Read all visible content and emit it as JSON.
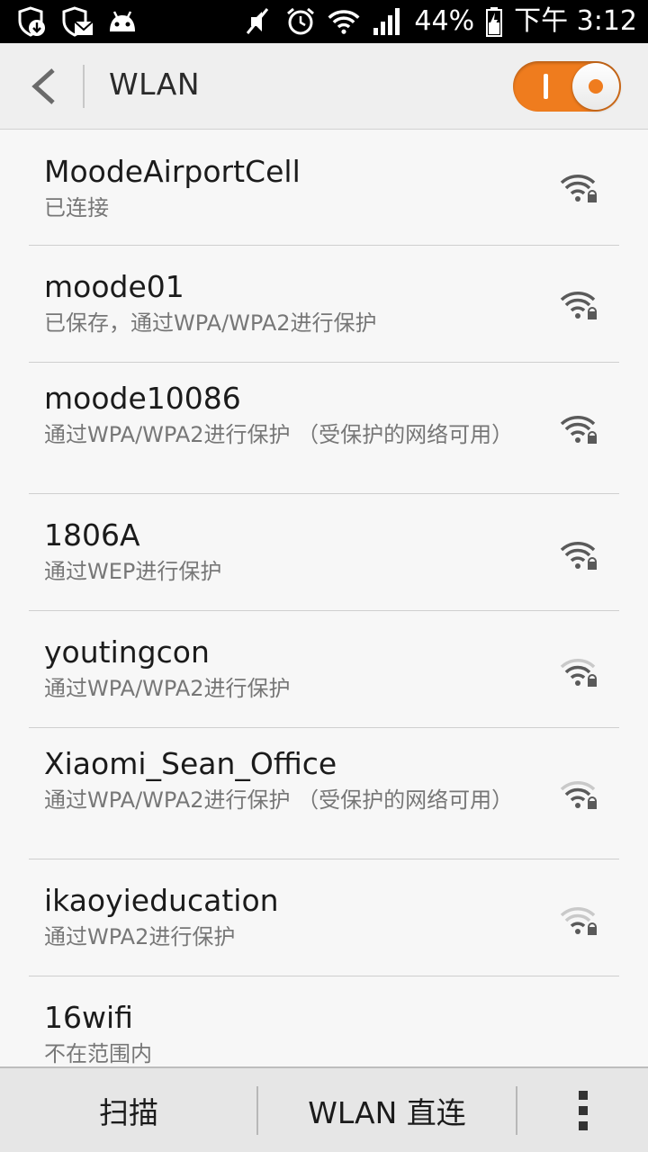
{
  "status_bar": {
    "battery": "44%",
    "time": "下午 3:12",
    "left_icons": [
      "shield-download-icon",
      "shield-mail-icon",
      "android-icon"
    ],
    "right_icons": [
      "mute-icon",
      "alarm-icon",
      "wifi-icon",
      "signal-icon",
      "battery-charging-icon"
    ]
  },
  "header": {
    "title": "WLAN",
    "back_icon": "chevron-left-icon",
    "toggle_on": true,
    "accent_color": "#ef7c1e"
  },
  "networks": [
    {
      "ssid": "MoodeAirportCell",
      "status": "已连接",
      "signal": "strong",
      "locked": true
    },
    {
      "ssid": "moode01",
      "status": "已保存，通过WPA/WPA2进行保护",
      "signal": "strong",
      "locked": true
    },
    {
      "ssid": "moode10086",
      "status": "通过WPA/WPA2进行保护 （受保护的网络可用）",
      "signal": "strong",
      "locked": true
    },
    {
      "ssid": "1806A",
      "status": "通过WEP进行保护",
      "signal": "strong",
      "locked": true
    },
    {
      "ssid": "youtingcon",
      "status": "通过WPA/WPA2进行保护",
      "signal": "medium",
      "locked": true
    },
    {
      "ssid": "Xiaomi_Sean_Office",
      "status": "通过WPA/WPA2进行保护 （受保护的网络可用）",
      "signal": "medium",
      "locked": true
    },
    {
      "ssid": "ikaoyieducation",
      "status": "通过WPA2进行保护",
      "signal": "weak",
      "locked": true
    },
    {
      "ssid": "16wifi",
      "status": "不在范围内",
      "signal": "none",
      "locked": false
    }
  ],
  "bottom_bar": {
    "scan_label": "扫描",
    "direct_label": "WLAN 直连",
    "more_icon": "more-vertical-icon"
  }
}
